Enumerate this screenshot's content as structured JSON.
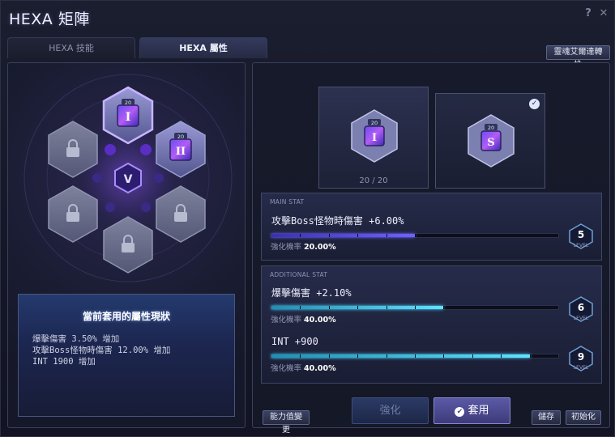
{
  "window": {
    "title": "HEXA 矩陣",
    "help_glyph": "?",
    "close_glyph": "✕"
  },
  "tabs": [
    {
      "label": "HEXA 技能",
      "active": false
    },
    {
      "label": "HEXA 屬性",
      "active": true
    }
  ],
  "soul_convert_button": "靈魂艾爾達轉換",
  "matrix": {
    "center_icon": "hexa-v-logo",
    "nodes": [
      {
        "slot": "top",
        "level_badge": "20",
        "glyph": "I",
        "locked": false,
        "selected": true
      },
      {
        "slot": "upper-right",
        "level_badge": "20",
        "glyph": "II",
        "locked": false,
        "selected": false
      },
      {
        "slot": "upper-left",
        "locked": true
      },
      {
        "slot": "lower-left",
        "locked": true
      },
      {
        "slot": "lower-right",
        "locked": true
      },
      {
        "slot": "bottom",
        "locked": true
      }
    ]
  },
  "current_status": {
    "title": "當前套用的屬性現狀",
    "lines": [
      "爆擊傷害 3.50% 增加",
      "攻擊Boss怪物時傷害 12.00% 增加",
      "INT 1900 增加"
    ]
  },
  "cards": [
    {
      "badge": "20",
      "glyph": "I",
      "count": "20 / 20",
      "selected": false
    },
    {
      "badge": "20",
      "glyph": "S",
      "count": "",
      "selected": true
    }
  ],
  "main_stat": {
    "header": "MAIN STAT",
    "name": "攻擊Boss怪物時傷害 +6.00%",
    "chance_label": "強化機率",
    "chance_value": "20.00%",
    "progress": 0.5,
    "level": "5",
    "level_label": "LEVEL",
    "bar_color": "#6d63ff"
  },
  "additional_stats": {
    "header": "ADDITIONAL STAT",
    "items": [
      {
        "name": "爆擊傷害 +2.10%",
        "chance_label": "強化機率",
        "chance_value": "40.00%",
        "progress": 0.6,
        "level": "6",
        "level_label": "LEVEL",
        "bar_color": "#5fe3ff"
      },
      {
        "name": "INT +900",
        "chance_label": "強化機率",
        "chance_value": "40.00%",
        "progress": 0.9,
        "level": "9",
        "level_label": "LEVEL",
        "bar_color": "#5fe3ff"
      }
    ]
  },
  "buttons": {
    "stat_change": "能力值變更",
    "enhance": "強化",
    "apply": "套用",
    "apply_icon": "✔",
    "save": "儲存",
    "reset": "初始化"
  }
}
